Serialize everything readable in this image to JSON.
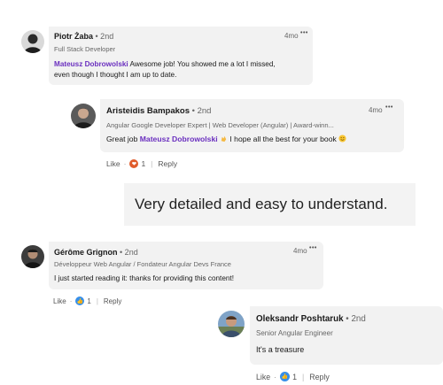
{
  "comments": [
    {
      "name": "Piotr Żaba",
      "degree": "• 2nd",
      "headline": "Full Stack Developer",
      "time": "4mo",
      "more": "•••",
      "mention": "Mateusz Dobrowolski",
      "text_line1": " Awesome job! You showed me a lot I missed,",
      "text_line2": "even though I thought I am up to date."
    },
    {
      "name": "Aristeidis Bampakos",
      "degree": "• 2nd",
      "headline": "Angular Google Developer Expert | Web Developer (Angular) | Award-winn...",
      "time": "4mo",
      "more": "•••",
      "text_before": "Great job ",
      "mention": "Mateusz Dobrowolski",
      "text_after": " I hope all the best for your book ",
      "actions": {
        "like": "Like",
        "sep": "·",
        "count": "1",
        "reply": "Reply"
      }
    },
    {
      "name": "Gérôme Grignon",
      "degree": "• 2nd",
      "headline": "Développeur Web Angular / Fondateur Angular Devs France",
      "time": "4mo",
      "more": "•••",
      "text": "I just started reading it: thanks for providing this content!",
      "actions": {
        "like": "Like",
        "sep": "·",
        "count": "1",
        "reply": "Reply"
      }
    },
    {
      "name": "Oleksandr Poshtaruk",
      "degree": "• 2nd",
      "headline": "Senior Angular Engineer",
      "text": "It's a treasure",
      "actions": {
        "like": "Like",
        "sep": "·",
        "count": "1",
        "reply": "Reply"
      }
    }
  ],
  "callout": "Very detailed and easy to understand.",
  "colors": {
    "mention": "#6a2fbf",
    "love": "#e05c2c",
    "like": "#378fe9"
  },
  "icons": [
    "avatar",
    "clap-emoji",
    "smile-emoji",
    "love-reaction-icon",
    "like-reaction-icon",
    "more-icon"
  ]
}
